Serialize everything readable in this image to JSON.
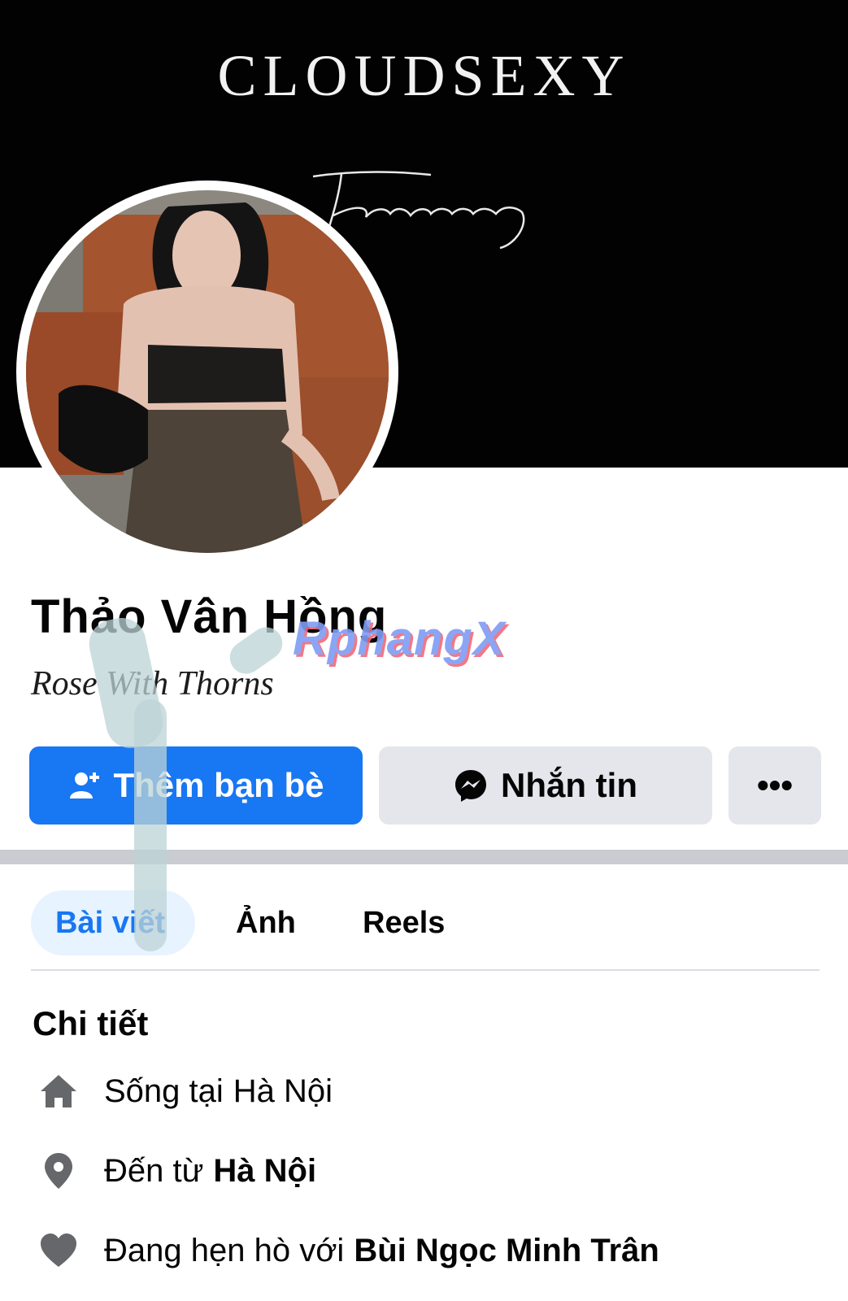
{
  "cover": {
    "logo_text": "CLOUDSEXY",
    "signature_text": "Thaovannong"
  },
  "profile": {
    "name": "Thảo Vân Hồng",
    "bio": "Rose With Thorns"
  },
  "watermark": "RphangX",
  "actions": {
    "add_friend_label": "Thêm bạn bè",
    "message_label": "Nhắn tin",
    "more_label": "•••"
  },
  "tabs": [
    {
      "label": "Bài viết",
      "active": true
    },
    {
      "label": "Ảnh",
      "active": false
    },
    {
      "label": "Reels",
      "active": false
    }
  ],
  "details": {
    "title": "Chi tiết",
    "items": [
      {
        "icon": "home-icon",
        "prefix": "Sống tại",
        "value": "Hà Nội"
      },
      {
        "icon": "location-pin-icon",
        "prefix": "Đến từ",
        "value": "Hà Nội"
      },
      {
        "icon": "heart-icon",
        "prefix": "Đang hẹn hò với",
        "value": "Bùi Ngọc Minh Trân"
      }
    ]
  },
  "colors": {
    "accent": "#1877f2",
    "button_gray": "#e4e6eb",
    "cover_bg": "#020202",
    "icon_gray": "#65676b"
  }
}
